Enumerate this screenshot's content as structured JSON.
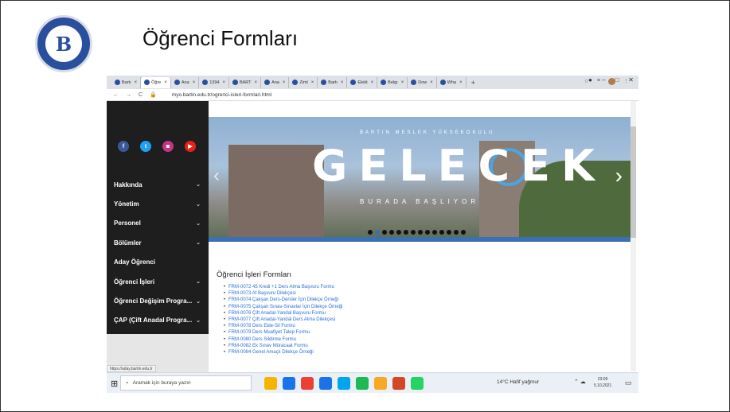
{
  "slide": {
    "title": "Öğrenci Formları",
    "logo_letter": "B"
  },
  "browser": {
    "tabs": [
      {
        "label": "Bartı",
        "active": false
      },
      {
        "label": "Öğre",
        "active": true
      },
      {
        "label": "Ana",
        "active": false
      },
      {
        "label": "1394",
        "active": false
      },
      {
        "label": "BART",
        "active": false
      },
      {
        "label": "Ana",
        "active": false
      },
      {
        "label": "Ziml",
        "active": false
      },
      {
        "label": "Bartı",
        "active": false
      },
      {
        "label": "Elekt",
        "active": false
      },
      {
        "label": "Belgı",
        "active": false
      },
      {
        "label": "Dow",
        "active": false
      },
      {
        "label": "Wha",
        "active": false
      }
    ],
    "new_tab": "+",
    "url": "myo.bartin.edu.tr/ogrenci-isleri-formlari.html",
    "status_url": "https://aday.bartin.edu.tr"
  },
  "sidebar": {
    "social": [
      "f",
      "t",
      "◙",
      "▶"
    ],
    "social_colors": [
      "#3b5998",
      "#1da1f2",
      "#c13584",
      "#e62117"
    ],
    "items": [
      {
        "label": "Hakkında",
        "chevron": true
      },
      {
        "label": "Yönetim",
        "chevron": true
      },
      {
        "label": "Personel",
        "chevron": true
      },
      {
        "label": "Bölümler",
        "chevron": true
      },
      {
        "label": "Aday Öğrenci",
        "chevron": false
      },
      {
        "label": "Öğrenci İşleri",
        "chevron": true
      },
      {
        "label": "Öğrenci Değişim Progra...",
        "chevron": true
      },
      {
        "label": "ÇAP (Çift Anadal Progra...",
        "chevron": true
      }
    ]
  },
  "banner": {
    "top_text": "BARTIN MESLEK YÜKSEKOKULU",
    "word": "GELECEK",
    "subtitle": "BURADA BAŞLIYOR",
    "slide_count": 14,
    "active_slide": 1
  },
  "content": {
    "heading": "Öğrenci İşleri Formları",
    "forms": [
      "FRM-0072 45 Kredi +1 Ders Alma Başvuru Formu",
      "FRM-0073 Af Başvuru Dilekçesi",
      "FRM-0074 Çalışan Ders-Dersler İçin Dilekçe Örneği",
      "FRM-0075 Çalışan Sınav-Sınavlar İçin Dilekçe Örneği",
      "FRM-0076 Çift Anadal-Yandal Başvuru Formu",
      "FRM-0077 Çift Anadal-Yandal Ders Alma Dilekçesi",
      "FRM-0078 Ders Ekle-Sil Formu",
      "FRM-0079 Ders Muafiyet Talep Formu",
      "FRM-0080 Ders Sildirme Formu",
      "FRM-0082 Ek Sınav Müracaat Formu",
      "FRM-0084 Genel Amaçlı Dilekçe Örneği"
    ]
  },
  "taskbar": {
    "search_placeholder": "Aramak için buraya yazın",
    "weather": "14°C  Hafif yağmur",
    "time": "23:09",
    "date": "5.10.2021",
    "app_colors": [
      "#f4b400",
      "#1a73e8",
      "#e94235",
      "#1a73e8",
      "#00a4ef",
      "#1db954",
      "#f9a825",
      "#d24726",
      "#25d366"
    ]
  }
}
